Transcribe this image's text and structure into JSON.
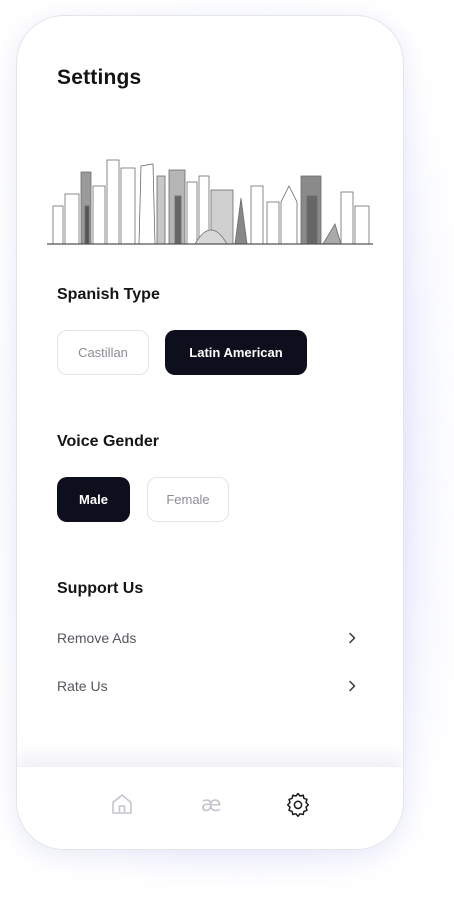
{
  "header": {
    "title": "Settings"
  },
  "illustration": {
    "icon": "city-skyline-illustration"
  },
  "spanish_type": {
    "title": "Spanish Type",
    "options": [
      {
        "label": "Castillan",
        "selected": false
      },
      {
        "label": "Latin American",
        "selected": true
      }
    ]
  },
  "voice_gender": {
    "title": "Voice Gender",
    "options": [
      {
        "label": "Male",
        "selected": true
      },
      {
        "label": "Female",
        "selected": false
      }
    ]
  },
  "support": {
    "title": "Support Us",
    "items": [
      {
        "label": "Remove Ads",
        "icon": "chevron-right-icon"
      },
      {
        "label": "Rate Us",
        "icon": "chevron-right-icon"
      }
    ]
  },
  "bottom_nav": {
    "items": [
      {
        "icon": "home-icon",
        "active": false
      },
      {
        "icon": "ae-ligature-icon",
        "active": false
      },
      {
        "icon": "gear-icon",
        "active": true
      }
    ]
  },
  "colors": {
    "accent": "#0e0f1c",
    "text_primary": "#141414",
    "text_secondary": "#55565e",
    "inactive_icon": "#c4c6cf"
  }
}
